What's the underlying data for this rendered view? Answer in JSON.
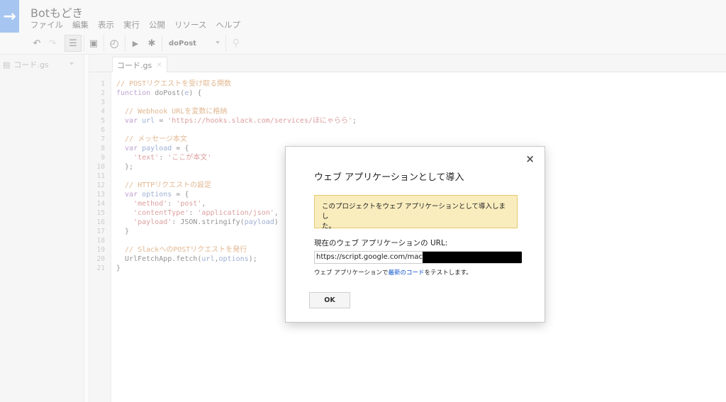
{
  "app": {
    "title": "Botもどき",
    "logo_glyph": "→"
  },
  "menu": [
    "ファイル",
    "編集",
    "表示",
    "実行",
    "公開",
    "リソース",
    "ヘルプ"
  ],
  "toolbar": {
    "undo": "↶",
    "redo": "↷",
    "indent": "☰",
    "save": "▣",
    "triggers": "◴",
    "run": "▶",
    "debug": "✱",
    "function_select": "doPost",
    "bulb": "⚲"
  },
  "sidebar": {
    "file": "コード.gs"
  },
  "tab": {
    "label": "コード.gs",
    "close": "×"
  },
  "code": {
    "line_numbers": [
      "1",
      "2",
      "3",
      "4",
      "5",
      "6",
      "7",
      "8",
      "9",
      "10",
      "11",
      "12",
      "13",
      "14",
      "15",
      "16",
      "17",
      "18",
      "19",
      "20",
      "21"
    ],
    "lines": [
      [
        {
          "t": "// POSTリクエストを受け取る関数",
          "c": "#c36d1f"
        }
      ],
      [
        {
          "t": "function ",
          "c": "#7a3e9d"
        },
        {
          "t": "doPost(",
          "c": "#222"
        },
        {
          "t": "e",
          "c": "#3b5ca8"
        },
        {
          "t": ") {",
          "c": "#222"
        }
      ],
      [],
      [
        {
          "t": "  // Webhook URLを変数に格納",
          "c": "#c36d1f"
        }
      ],
      [
        {
          "t": "  var ",
          "c": "#7a3e9d"
        },
        {
          "t": "url",
          "c": "#3b5ca8"
        },
        {
          "t": " = ",
          "c": "#222"
        },
        {
          "t": "'https://hooks.slack.com/services/ほにゃらら'",
          "c": "#b83a3a"
        },
        {
          "t": ";",
          "c": "#222"
        }
      ],
      [],
      [
        {
          "t": "  // メッセージ本文",
          "c": "#c36d1f"
        }
      ],
      [
        {
          "t": "  var ",
          "c": "#7a3e9d"
        },
        {
          "t": "payload",
          "c": "#3b5ca8"
        },
        {
          "t": " = {",
          "c": "#222"
        }
      ],
      [
        {
          "t": "    'text'",
          "c": "#b83a3a"
        },
        {
          "t": ": ",
          "c": "#222"
        },
        {
          "t": "'ここが本文'",
          "c": "#b83a3a"
        }
      ],
      [
        {
          "t": "  };",
          "c": "#222"
        }
      ],
      [],
      [
        {
          "t": "  // HTTPリクエストの設定",
          "c": "#c36d1f"
        }
      ],
      [
        {
          "t": "  var ",
          "c": "#7a3e9d"
        },
        {
          "t": "options",
          "c": "#3b5ca8"
        },
        {
          "t": " = {",
          "c": "#222"
        }
      ],
      [
        {
          "t": "    'method'",
          "c": "#b83a3a"
        },
        {
          "t": ": ",
          "c": "#222"
        },
        {
          "t": "'post'",
          "c": "#b83a3a"
        },
        {
          "t": ",",
          "c": "#222"
        }
      ],
      [
        {
          "t": "    'contentType'",
          "c": "#b83a3a"
        },
        {
          "t": ": ",
          "c": "#222"
        },
        {
          "t": "'application/json'",
          "c": "#b83a3a"
        },
        {
          "t": ",",
          "c": "#222"
        }
      ],
      [
        {
          "t": "    'payload'",
          "c": "#b83a3a"
        },
        {
          "t": ": JSON.stringify(",
          "c": "#222"
        },
        {
          "t": "payload",
          "c": "#3b5ca8"
        },
        {
          "t": ")",
          "c": "#222"
        }
      ],
      [
        {
          "t": "  }",
          "c": "#222"
        }
      ],
      [],
      [
        {
          "t": "  // SlackへのPOSTリクエストを発行",
          "c": "#c36d1f"
        }
      ],
      [
        {
          "t": "  UrlFetchApp.fetch(",
          "c": "#222"
        },
        {
          "t": "url",
          "c": "#3b5ca8"
        },
        {
          "t": ",",
          "c": "#222"
        },
        {
          "t": "options",
          "c": "#3b5ca8"
        },
        {
          "t": ");",
          "c": "#222"
        }
      ],
      [
        {
          "t": "}",
          "c": "#222"
        }
      ]
    ]
  },
  "dialog": {
    "title": "ウェブ アプリケーションとして導入",
    "close": "×",
    "notice_line1": "このプロジェクトをウェブ アプリケーションとして導入しまし",
    "notice_line2": "た。",
    "url_label": "現在のウェブ アプリケーションの URL:",
    "url_value": "https://script.google.com/macros",
    "note_prefix": "ウェブ アプリケーションで",
    "note_link": "最新のコード",
    "note_suffix": "をテストします。",
    "ok": "OK"
  }
}
